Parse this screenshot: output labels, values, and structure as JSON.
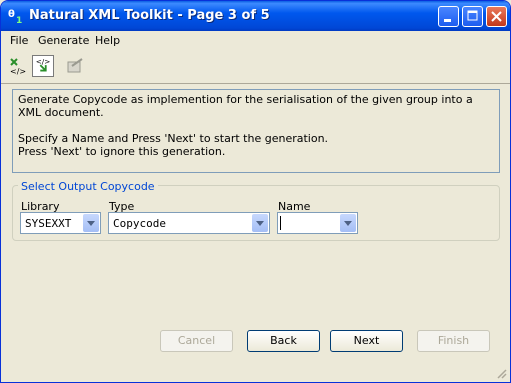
{
  "window": {
    "title": "Natural XML Toolkit - Page 3 of 5"
  },
  "menu": {
    "items": [
      "File",
      "Generate",
      "Help"
    ]
  },
  "info": {
    "line1": "Generate Copycode as implemention for the serialisation of the given group into a XML document.",
    "line2": "Specify a Name and Press 'Next' to start the generation.",
    "line3": "Press 'Next' to ignore this generation."
  },
  "group": {
    "title": "Select Output Copycode",
    "library_label": "Library",
    "library_value": "SYSEXXT",
    "type_label": "Type",
    "type_value": "Copycode",
    "name_label": "Name",
    "name_value": ""
  },
  "buttons": {
    "cancel": "Cancel",
    "back": "Back",
    "next": "Next",
    "finish": "Finish"
  },
  "icons": [
    "app-icon",
    "xml-structure-icon",
    "generate-copycode-icon",
    "edit-icon"
  ]
}
